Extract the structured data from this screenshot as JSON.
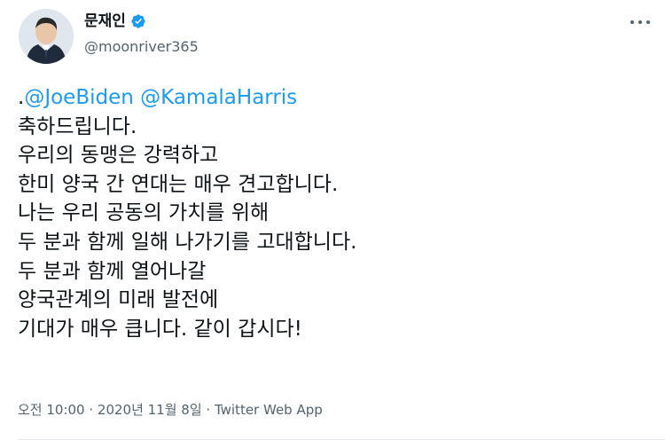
{
  "tweet": {
    "author": {
      "display_name": "문재인",
      "handle": "@moonriver365",
      "verified": true,
      "avatar_icon": "profile-photo"
    },
    "body": {
      "line1": {
        "prefix": ".",
        "mention1": "@JoeBiden",
        "mention2": "@KamalaHarris"
      },
      "lines": [
        "축하드립니다.",
        "우리의 동맹은 강력하고",
        "한미 양국 간 연대는 매우 견고합니다.",
        "나는 우리 공동의 가치를 위해",
        "두 분과 함께 일해 나가기를 고대합니다.",
        "두 분과 함께 열어나갈",
        "양국관계의 미래 발전에",
        "기대가 매우 큽니다. 같이 갑시다!"
      ]
    },
    "meta": "오전 10:00 · 2020년 11월 8일 · Twitter Web App",
    "colors": {
      "mention": "#1d9bf0",
      "verified": "#1d9bf0",
      "secondary_text": "#536471"
    },
    "more_icon": "more-horizontal-icon"
  }
}
